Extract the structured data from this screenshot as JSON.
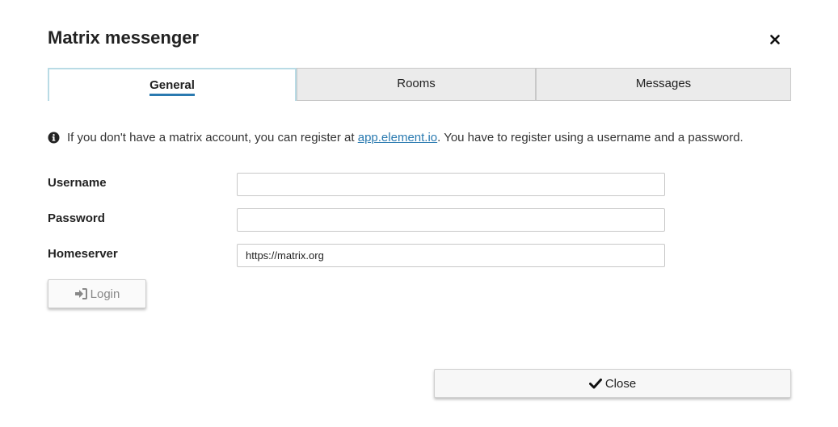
{
  "dialog": {
    "title": "Matrix messenger",
    "close_icon": "close-icon"
  },
  "tabs": [
    {
      "label": "General",
      "active": true
    },
    {
      "label": "Rooms",
      "active": false
    },
    {
      "label": "Messages",
      "active": false
    }
  ],
  "info": {
    "icon": "info-circle-icon",
    "text_before": "If you don't have a matrix account, you can register at ",
    "link_text": "app.element.io",
    "text_after": ". You have to register using a username and a password."
  },
  "form": {
    "username_label": "Username",
    "username_value": "",
    "password_label": "Password",
    "password_value": "",
    "homeserver_label": "Homeserver",
    "homeserver_value": "https://matrix.org"
  },
  "buttons": {
    "login_label": "Login",
    "login_icon": "sign-in-icon",
    "close_label": "Close",
    "close_icon": "check-icon"
  },
  "colors": {
    "accent": "#2a7ab0",
    "active_tab_border": "#b9dbe5",
    "tab_background": "#ebebeb"
  }
}
